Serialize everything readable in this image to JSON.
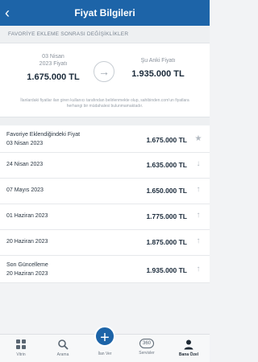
{
  "header": {
    "title": "Fiyat Bilgileri",
    "back_icon": "chevron-left-icon"
  },
  "section": {
    "title": "FAVORİYE EKLEME SONRASI DEĞİŞİKLİKLER"
  },
  "compare": {
    "left_date_line1": "03 Nisan",
    "left_date_line2": "2023 Fiyatı",
    "left_price": "1.675.000 TL",
    "arrow_icon": "arrow-right-icon",
    "right_label": "Şu Anki Fiyatı",
    "right_price": "1.935.000 TL",
    "note": "İlanlardaki fiyatlar ilan giren kullanıcı tarafından belirlenmekte olup, sahibinden.com'un fiyatlara herhangi bir müdahalesi bulunmamaktadır."
  },
  "history": [
    {
      "label1": "Favoriye Eklendiğindeki Fiyat",
      "label2": "03 Nisan 2023",
      "price": "1.675.000 TL",
      "indicator": "★"
    },
    {
      "label1": "24 Nisan 2023",
      "price": "1.635.000 TL",
      "indicator": "↓"
    },
    {
      "label1": "07 Mayıs 2023",
      "price": "1.650.000 TL",
      "indicator": "↑"
    },
    {
      "label1": "01 Haziran 2023",
      "price": "1.775.000 TL",
      "indicator": "↑"
    },
    {
      "label1": "20 Haziran 2023",
      "price": "1.875.000 TL",
      "indicator": "↑"
    },
    {
      "label1": "Son Güncelleme",
      "label2": "20 Haziran 2023",
      "price": "1.935.000 TL",
      "indicator": "↑"
    }
  ],
  "tabbar": {
    "items": [
      {
        "label": "Vitrin",
        "icon": "grid-icon"
      },
      {
        "label": "Arama",
        "icon": "search-icon"
      },
      {
        "label": "İlan Ver",
        "icon": "plus-icon"
      },
      {
        "label": "Servisler",
        "icon": "360-icon",
        "icon_text": "360"
      },
      {
        "label": "Bana Özel",
        "icon": "user-icon"
      }
    ],
    "active": "Bana Özel"
  },
  "colors": {
    "brand": "#1d64a8"
  }
}
